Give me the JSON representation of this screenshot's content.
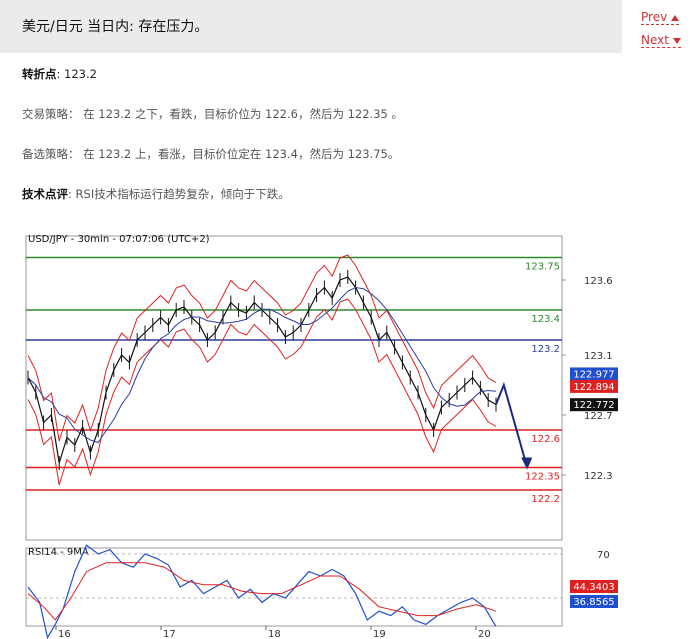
{
  "page": {
    "title": "美元/日元 当日内: 存在压力。",
    "prev_label": "Prev",
    "next_label": "Next"
  },
  "analysis": {
    "pivot_label": "转折点",
    "pivot_value": ": 123.2",
    "strategy_label": "交易策略",
    "strategy_text": "： 在 123.2 之下，看跌，目标价位为 122.6，然后为 122.35 。",
    "alt_label": "备选策略",
    "alt_text": "： 在 123.2 上，看涨，目标价位定在 123.4，然后为 123.75。",
    "comment_label": "技术点评",
    "comment_text": ": RSI技术指标运行趋势复杂，倾向于下跌。"
  },
  "chart_data": {
    "type": "line",
    "title": "USD/JPY - 30min - 07:07:06 (UTC+2)",
    "price_axis": [
      123.6,
      123.1,
      122.7,
      122.3
    ],
    "x_ticks": [
      "16",
      "17",
      "18",
      "19",
      "20"
    ],
    "levels": [
      {
        "label": "123.75",
        "value": 123.75,
        "color": "#2e8b2e"
      },
      {
        "label": "123.4",
        "value": 123.4,
        "color": "#2e8b2e"
      },
      {
        "label": "123.2",
        "value": 123.2,
        "color": "#2b3fa0"
      },
      {
        "label": "122.6",
        "value": 122.6,
        "color": "#e02020"
      },
      {
        "label": "122.35",
        "value": 122.35,
        "color": "#e02020"
      },
      {
        "label": "122.2",
        "value": 122.2,
        "color": "#e02020"
      }
    ],
    "tags": [
      {
        "label": "122.977",
        "value": 122.977,
        "color": "#2050d0"
      },
      {
        "label": "122.894",
        "value": 122.894,
        "color": "#e02020"
      },
      {
        "label": "122.772",
        "value": 122.772,
        "color": "#111111"
      }
    ],
    "price_path": [
      [
        0,
        122.95
      ],
      [
        4,
        122.85
      ],
      [
        8,
        122.65
      ],
      [
        12,
        122.7
      ],
      [
        16,
        122.38
      ],
      [
        20,
        122.55
      ],
      [
        24,
        122.5
      ],
      [
        28,
        122.62
      ],
      [
        32,
        122.45
      ],
      [
        36,
        122.6
      ],
      [
        40,
        122.85
      ],
      [
        44,
        123.0
      ],
      [
        48,
        123.1
      ],
      [
        52,
        123.05
      ],
      [
        56,
        123.2
      ],
      [
        60,
        123.25
      ],
      [
        64,
        123.3
      ],
      [
        68,
        123.35
      ],
      [
        72,
        123.3
      ],
      [
        76,
        123.4
      ],
      [
        80,
        123.42
      ],
      [
        84,
        123.35
      ],
      [
        88,
        123.3
      ],
      [
        92,
        123.2
      ],
      [
        96,
        123.25
      ],
      [
        100,
        123.35
      ],
      [
        104,
        123.45
      ],
      [
        108,
        123.4
      ],
      [
        112,
        123.38
      ],
      [
        116,
        123.45
      ],
      [
        120,
        123.4
      ],
      [
        124,
        123.35
      ],
      [
        128,
        123.3
      ],
      [
        132,
        123.22
      ],
      [
        136,
        123.25
      ],
      [
        140,
        123.3
      ],
      [
        144,
        123.4
      ],
      [
        148,
        123.5
      ],
      [
        152,
        123.55
      ],
      [
        156,
        123.48
      ],
      [
        160,
        123.6
      ],
      [
        164,
        123.62
      ],
      [
        168,
        123.55
      ],
      [
        172,
        123.45
      ],
      [
        176,
        123.35
      ],
      [
        180,
        123.2
      ],
      [
        184,
        123.25
      ],
      [
        188,
        123.15
      ],
      [
        192,
        123.05
      ],
      [
        196,
        122.95
      ],
      [
        200,
        122.85
      ],
      [
        204,
        122.7
      ],
      [
        208,
        122.6
      ],
      [
        212,
        122.75
      ],
      [
        216,
        122.8
      ],
      [
        220,
        122.85
      ],
      [
        224,
        122.9
      ],
      [
        228,
        122.95
      ],
      [
        232,
        122.88
      ],
      [
        236,
        122.8
      ],
      [
        240,
        122.77
      ]
    ],
    "forecast_path": [
      [
        240,
        122.77
      ],
      [
        244,
        122.9
      ],
      [
        256,
        122.35
      ]
    ],
    "rsi_label": "RSI14 - 9MA",
    "rsi_axis": [
      70,
      50
    ],
    "rsi_tags": [
      {
        "label": "44.3403",
        "color": "#e02020"
      },
      {
        "label": "36.8565",
        "color": "#2050d0"
      }
    ],
    "rsi_path": [
      [
        0,
        55
      ],
      [
        6,
        48
      ],
      [
        10,
        32
      ],
      [
        14,
        38
      ],
      [
        18,
        45
      ],
      [
        24,
        62
      ],
      [
        30,
        74
      ],
      [
        36,
        70
      ],
      [
        42,
        72
      ],
      [
        48,
        66
      ],
      [
        54,
        64
      ],
      [
        60,
        70
      ],
      [
        66,
        68
      ],
      [
        72,
        65
      ],
      [
        78,
        55
      ],
      [
        84,
        58
      ],
      [
        90,
        52
      ],
      [
        96,
        55
      ],
      [
        102,
        58
      ],
      [
        108,
        50
      ],
      [
        114,
        54
      ],
      [
        120,
        48
      ],
      [
        126,
        52
      ],
      [
        132,
        50
      ],
      [
        138,
        56
      ],
      [
        144,
        62
      ],
      [
        150,
        60
      ],
      [
        156,
        63
      ],
      [
        162,
        60
      ],
      [
        168,
        52
      ],
      [
        174,
        40
      ],
      [
        180,
        44
      ],
      [
        186,
        42
      ],
      [
        192,
        46
      ],
      [
        198,
        40
      ],
      [
        204,
        38
      ],
      [
        210,
        42
      ],
      [
        216,
        45
      ],
      [
        222,
        48
      ],
      [
        228,
        50
      ],
      [
        234,
        46
      ],
      [
        240,
        37
      ]
    ],
    "rsi_ma_path": [
      [
        0,
        52
      ],
      [
        8,
        46
      ],
      [
        14,
        40
      ],
      [
        22,
        50
      ],
      [
        30,
        62
      ],
      [
        40,
        66
      ],
      [
        50,
        66
      ],
      [
        60,
        66
      ],
      [
        70,
        64
      ],
      [
        80,
        58
      ],
      [
        90,
        56
      ],
      [
        100,
        56
      ],
      [
        110,
        53
      ],
      [
        120,
        52
      ],
      [
        130,
        52
      ],
      [
        140,
        56
      ],
      [
        150,
        60
      ],
      [
        160,
        60
      ],
      [
        170,
        54
      ],
      [
        180,
        46
      ],
      [
        190,
        44
      ],
      [
        200,
        42
      ],
      [
        210,
        42
      ],
      [
        220,
        45
      ],
      [
        230,
        47
      ],
      [
        240,
        44
      ]
    ]
  }
}
